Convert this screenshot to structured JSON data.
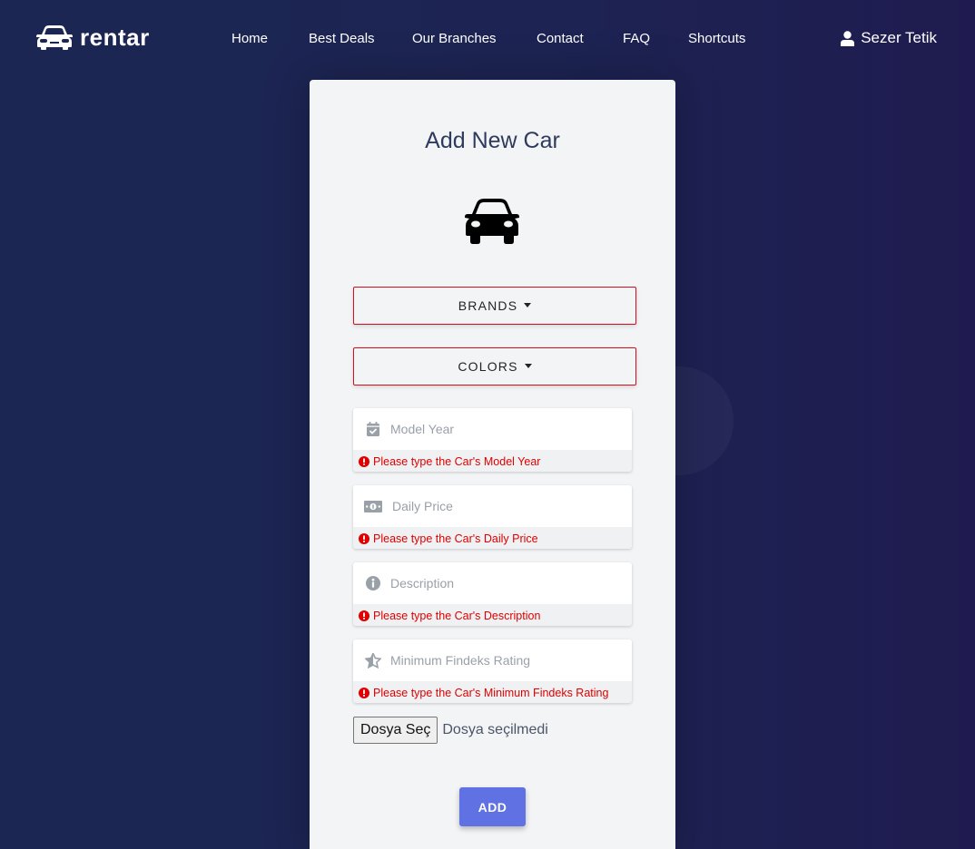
{
  "nav": {
    "brand": "rentar",
    "links": [
      "Home",
      "Best Deals",
      "Our Branches",
      "Contact",
      "FAQ",
      "Shortcuts"
    ],
    "user_name": "Sezer Tetik"
  },
  "form": {
    "title": "Add New Car",
    "brands_label": "BRANDS",
    "colors_label": "COLORS",
    "fields": [
      {
        "icon": "calendar-check-icon",
        "placeholder": "Model Year",
        "value": "",
        "error": "Please type the Car's Model Year"
      },
      {
        "icon": "money-bill-icon",
        "placeholder": "Daily Price",
        "value": "",
        "error": "Please type the Car's Daily Price"
      },
      {
        "icon": "info-circle-icon",
        "placeholder": "Description",
        "value": "",
        "error": "Please type the Car's Description"
      },
      {
        "icon": "star-half-icon",
        "placeholder": "Minimum Findeks Rating",
        "value": "",
        "error": "Please type the Car's Minimum Findeks Rating"
      }
    ],
    "file_button": "Dosya Seç",
    "file_status": "Dosya seçilmedi",
    "submit_label": "ADD"
  },
  "colors": {
    "background": "#1d2453",
    "card": "#f3f4f6",
    "error": "#e00000",
    "accent": "#6071e3",
    "dropdown_border": "#d1101b"
  }
}
